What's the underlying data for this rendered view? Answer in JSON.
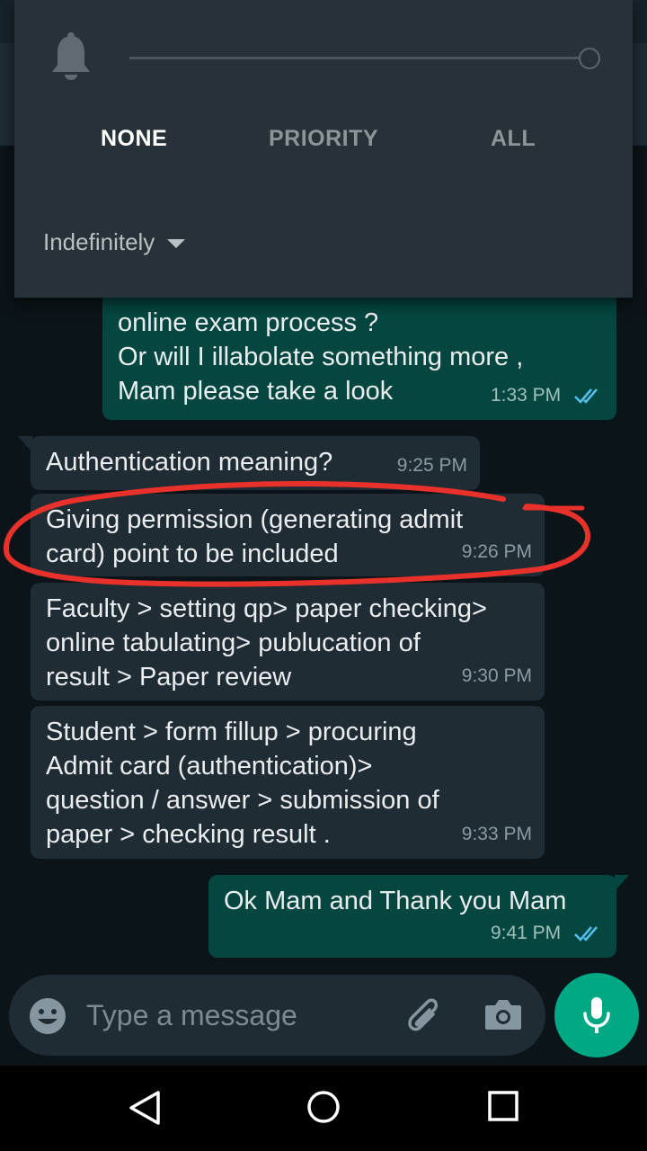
{
  "notification_panel": {
    "modes": [
      "NONE",
      "PRIORITY",
      "ALL"
    ],
    "selected_mode": "NONE",
    "duration": "Indefinitely"
  },
  "messages": [
    {
      "direction": "out",
      "text_lines": [
        "online exam process ?",
        "Or will I illabolate something more ,",
        "Mam please take a look"
      ],
      "time": "1:33 PM",
      "read": true
    },
    {
      "direction": "in",
      "text_lines": [
        "Authentication meaning?"
      ],
      "time": "9:25 PM"
    },
    {
      "direction": "in",
      "text_lines": [
        "Giving permission (generating admit",
        "card) point to be included"
      ],
      "time": "9:26 PM"
    },
    {
      "direction": "in",
      "text_lines": [
        "Faculty > setting qp> paper checking>",
        "online tabulating> publucation of",
        "result > Paper review"
      ],
      "time": "9:30 PM"
    },
    {
      "direction": "in",
      "text_lines": [
        "Student > form fillup > procuring",
        "Admit card (authentication)>",
        "question / answer > submission of",
        "paper > checking result ."
      ],
      "time": "9:33 PM"
    },
    {
      "direction": "out",
      "text_lines": [
        "Ok Mam and Thank you Mam"
      ],
      "time": "9:41 PM",
      "read": true
    }
  ],
  "composer": {
    "placeholder": "Type a message",
    "icons": [
      "emoji-icon",
      "paperclip-icon",
      "camera-icon",
      "microphone-icon"
    ]
  },
  "navigation": {
    "icons": [
      "back-icon",
      "home-icon",
      "recents-icon"
    ]
  },
  "colors": {
    "chat_background": "#0b1418",
    "incoming_bubble": "#1f2c34",
    "outgoing_bubble": "#054740",
    "accent": "#00a884",
    "read_ticks": "#53bdeb",
    "annotation": "#e8312a"
  }
}
